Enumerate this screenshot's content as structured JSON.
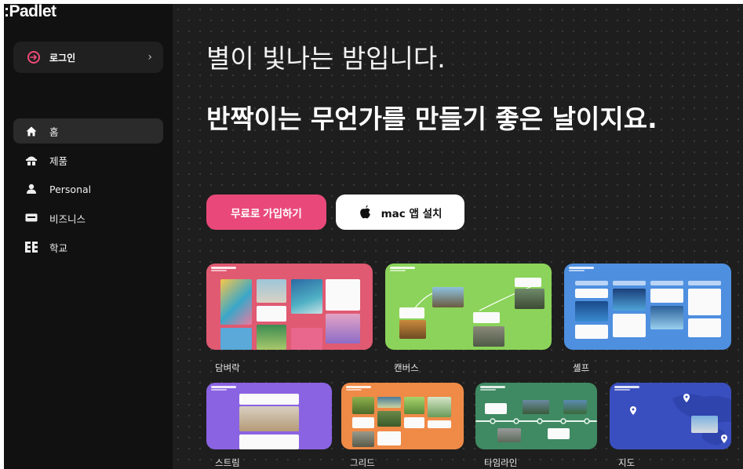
{
  "app": {
    "logo": ":Padlet"
  },
  "sidebar": {
    "login_label": "로그인",
    "items": [
      {
        "label": "홈",
        "icon": "home-icon",
        "active": true
      },
      {
        "label": "제품",
        "icon": "product-icon",
        "active": false
      },
      {
        "label": "Personal",
        "icon": "person-icon",
        "active": false
      },
      {
        "label": "비즈니스",
        "icon": "business-icon",
        "active": false
      },
      {
        "label": "학교",
        "icon": "school-icon",
        "active": false
      }
    ]
  },
  "hero": {
    "line1": "별이 빛나는 밤입니다.",
    "line2": "반짝이는 무언가를 만들기 좋은 날이지요."
  },
  "actions": {
    "signup_label": "무료로 가입하기",
    "mac_label": "mac 앱 설치"
  },
  "formats": [
    {
      "label": "담벼락",
      "color": "#e05a72"
    },
    {
      "label": "캔버스",
      "color": "#8bd35a"
    },
    {
      "label": "셸프",
      "color": "#4e8fe0"
    },
    {
      "label": "스트림",
      "color": "#8a63e2"
    },
    {
      "label": "그리드",
      "color": "#ef8a47"
    },
    {
      "label": "타임라인",
      "color": "#3f8a63"
    },
    {
      "label": "지도",
      "color": "#3a4fbf"
    }
  ],
  "colors": {
    "accent": "#e9497a",
    "sidebar_bg": "#111111",
    "main_bg": "#1e1e1e"
  }
}
